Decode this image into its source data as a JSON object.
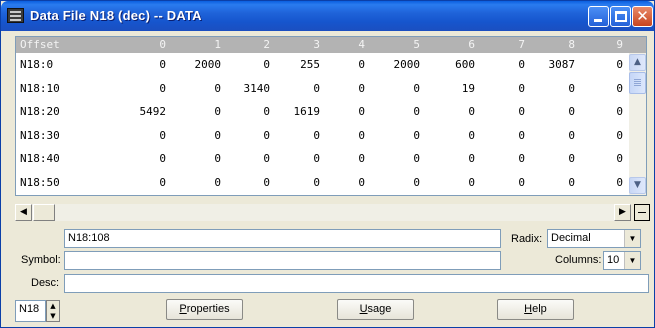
{
  "window": {
    "title": "Data File N18 (dec) -- DATA",
    "controls": {
      "minimize": "minimize-icon",
      "maximize": "maximize-icon",
      "close": "close-icon",
      "close_glyph": "✕"
    }
  },
  "grid": {
    "headers": [
      "Offset",
      "0",
      "1",
      "2",
      "3",
      "4",
      "5",
      "6",
      "7",
      "8",
      "9"
    ],
    "rows": [
      {
        "addr": "N18:0",
        "values": [
          "0",
          "2000",
          "0",
          "255",
          "0",
          "2000",
          "600",
          "0",
          "3087",
          "0"
        ]
      },
      {
        "addr": "N18:10",
        "values": [
          "0",
          "0",
          "3140",
          "0",
          "0",
          "0",
          "19",
          "0",
          "0",
          "0"
        ]
      },
      {
        "addr": "N18:20",
        "values": [
          "5492",
          "0",
          "0",
          "1619",
          "0",
          "0",
          "0",
          "0",
          "0",
          "0"
        ]
      },
      {
        "addr": "N18:30",
        "values": [
          "0",
          "0",
          "0",
          "0",
          "0",
          "0",
          "0",
          "0",
          "0",
          "0"
        ]
      },
      {
        "addr": "N18:40",
        "values": [
          "0",
          "0",
          "0",
          "0",
          "0",
          "0",
          "0",
          "0",
          "0",
          "0"
        ]
      },
      {
        "addr": "N18:50",
        "values": [
          "0",
          "0",
          "0",
          "0",
          "0",
          "0",
          "0",
          "0",
          "0",
          "0"
        ]
      }
    ]
  },
  "scroll": {
    "up_glyph": "▲",
    "down_glyph": "▼",
    "left_glyph": "◀",
    "right_glyph": "▶"
  },
  "panel": {
    "address_value": "N18:108",
    "radix_label": "Radix:",
    "radix_value": "Decimal",
    "symbol_label": "Symbol:",
    "symbol_value": "",
    "columns_label": "Columns:",
    "columns_value": "10",
    "desc_label": "Desc:",
    "desc_value": "",
    "file_value": "N18",
    "spin_up": "▲",
    "spin_down": "▼",
    "dropdown_glyph": "▼",
    "buttons": {
      "properties_accel": "P",
      "properties_rest": "roperties",
      "usage_accel": "U",
      "usage_rest": "sage",
      "help_accel": "H",
      "help_rest": "elp"
    }
  }
}
